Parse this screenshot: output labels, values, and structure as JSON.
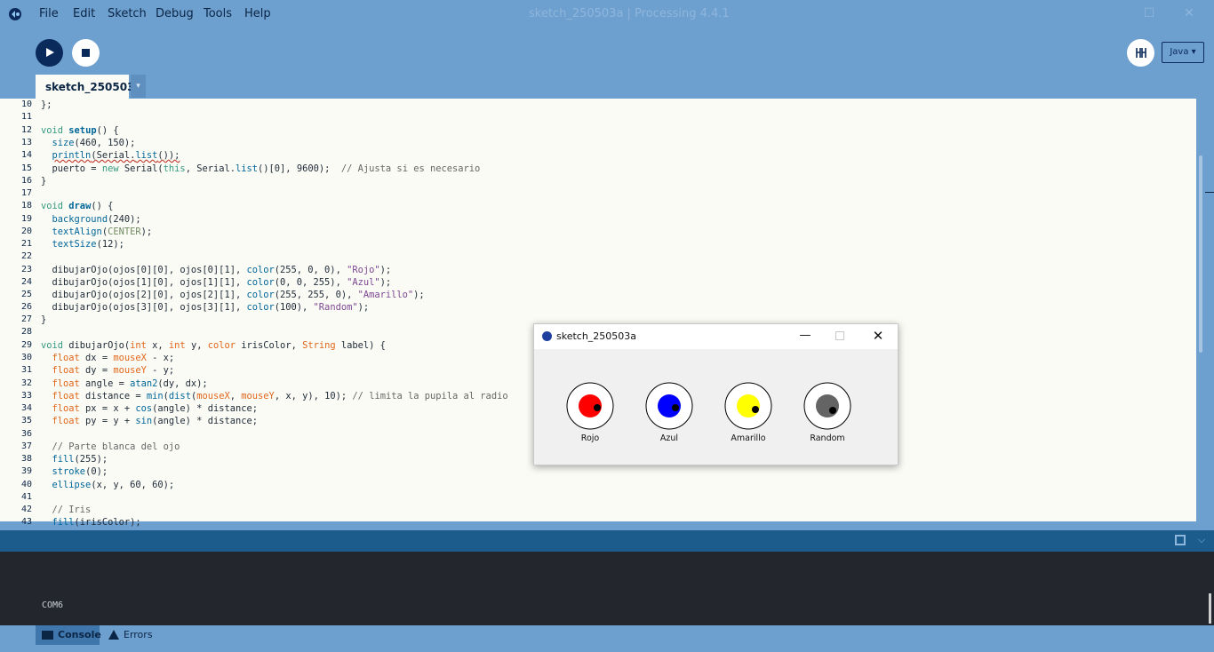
{
  "window": {
    "title": "sketch_250503a | Processing 4.4.1"
  },
  "menu": {
    "file": "File",
    "edit": "Edit",
    "sketch": "Sketch",
    "debug": "Debug",
    "tools": "Tools",
    "help": "Help"
  },
  "toolbar": {
    "mode": "Java ▾"
  },
  "tab": {
    "label": "sketch_250503a",
    "arrow": "▾"
  },
  "editor": {
    "line_numbers": [
      "10",
      "11",
      "12",
      "13",
      "14",
      "15",
      "16",
      "17",
      "18",
      "19",
      "20",
      "21",
      "22",
      "23",
      "24",
      "25",
      "26",
      "27",
      "28",
      "29",
      "30",
      "31",
      "32",
      "33",
      "34",
      "35",
      "36",
      "37",
      "38",
      "39",
      "40",
      "41",
      "42",
      "43"
    ]
  },
  "console": {
    "output": "COM6",
    "tab_console": "Console",
    "tab_errors": "Errors"
  },
  "sketch_window": {
    "title": "sketch_250503a",
    "eyes": [
      {
        "label": "Rojo",
        "iris": "#ff0000"
      },
      {
        "label": "Azul",
        "iris": "#0000ff"
      },
      {
        "label": "Amarillo",
        "iris": "#ffff00"
      },
      {
        "label": "Random",
        "iris": "#646464"
      }
    ]
  },
  "colors": {
    "accent": "#6d9fcf",
    "editor_bg": "#fbfbf6",
    "console_bg": "#23272d",
    "run_button": "#0b2a5c"
  }
}
